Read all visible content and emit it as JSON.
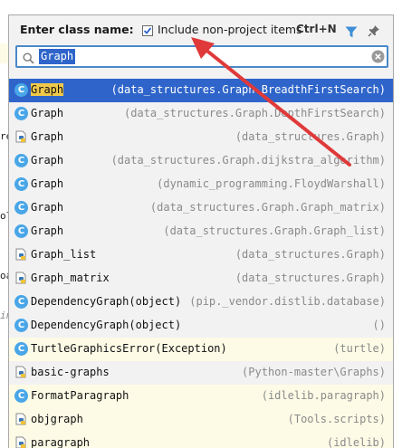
{
  "header": {
    "title": "Enter class name:",
    "include_label": "Include non-project items",
    "shortcut": "Ctrl+N",
    "include_checked": true
  },
  "search": {
    "value": "Graph"
  },
  "behind_fragments": [
    "re",
    "ol",
    "oal",
    "in"
  ],
  "colors": {
    "selection": "#2f65ca",
    "highlight": "#f0c94a",
    "row_tint": "#fdfbe6",
    "arrow": "#e0393a"
  },
  "results": [
    {
      "name_hl": "Graph",
      "name_rest": "",
      "location": "(data_structures.Graph.BreadthFirstSearch)",
      "icon": "class-icon",
      "selected": true,
      "tint": false
    },
    {
      "name_hl": "",
      "name_rest": "Graph",
      "location": "(data_structures.Graph.DepthFirstSearch)",
      "icon": "class-icon",
      "selected": false,
      "tint": false
    },
    {
      "name_hl": "",
      "name_rest": "Graph",
      "location": "(data_structures.Graph)",
      "icon": "python-file-icon",
      "selected": false,
      "tint": false
    },
    {
      "name_hl": "",
      "name_rest": "Graph",
      "location": "(data_structures.Graph.dijkstra_algorithm)",
      "icon": "class-icon",
      "selected": false,
      "tint": false
    },
    {
      "name_hl": "",
      "name_rest": "Graph",
      "location": "(dynamic_programming.FloydWarshall)",
      "icon": "class-icon",
      "selected": false,
      "tint": false
    },
    {
      "name_hl": "",
      "name_rest": "Graph",
      "location": "(data_structures.Graph.Graph_matrix)",
      "icon": "class-icon",
      "selected": false,
      "tint": false
    },
    {
      "name_hl": "",
      "name_rest": "Graph",
      "location": "(data_structures.Graph.Graph_list)",
      "icon": "class-icon",
      "selected": false,
      "tint": false
    },
    {
      "name_hl": "",
      "name_rest": "Graph_list",
      "location": "(data_structures.Graph)",
      "icon": "python-file-icon",
      "selected": false,
      "tint": false
    },
    {
      "name_hl": "",
      "name_rest": "Graph_matrix",
      "location": "(data_structures.Graph)",
      "icon": "python-file-icon",
      "selected": false,
      "tint": false
    },
    {
      "name_hl": "",
      "name_rest": "DependencyGraph(object)",
      "location": "(pip._vendor.distlib.database)",
      "icon": "class-icon",
      "selected": false,
      "tint": false
    },
    {
      "name_hl": "",
      "name_rest": "DependencyGraph(object)",
      "location": "()",
      "icon": "class-icon",
      "selected": false,
      "tint": false
    },
    {
      "name_hl": "",
      "name_rest": "TurtleGraphicsError(Exception)",
      "location": "(turtle)",
      "icon": "class-icon",
      "selected": false,
      "tint": true
    },
    {
      "name_hl": "",
      "name_rest": "basic-graphs",
      "location": "(Python-master\\Graphs)",
      "icon": "python-file-icon",
      "selected": false,
      "tint": false
    },
    {
      "name_hl": "",
      "name_rest": "FormatParagraph",
      "location": "(idlelib.paragraph)",
      "icon": "class-icon",
      "selected": false,
      "tint": true
    },
    {
      "name_hl": "",
      "name_rest": "objgraph",
      "location": "(Tools.scripts)",
      "icon": "python-file-icon",
      "selected": false,
      "tint": true
    },
    {
      "name_hl": "",
      "name_rest": "paragraph",
      "location": "(idlelib)",
      "icon": "python-file-icon",
      "selected": false,
      "tint": true
    }
  ]
}
